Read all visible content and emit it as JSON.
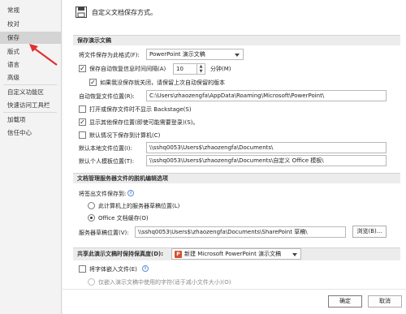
{
  "sidebar": {
    "items": [
      {
        "label": "常规"
      },
      {
        "label": "校对"
      },
      {
        "label": "保存"
      },
      {
        "label": "版式"
      },
      {
        "label": "语言"
      },
      {
        "label": "高级"
      },
      {
        "label": "自定义功能区"
      },
      {
        "label": "快速访问工具栏"
      },
      {
        "label": "加载项"
      },
      {
        "label": "信任中心"
      }
    ],
    "active_index": 2
  },
  "header": {
    "title": "自定义文档保存方式。",
    "icon": "save-icon"
  },
  "sections": {
    "save_presentations": "保存演示文稿",
    "offline_editing": "文档管理服务器文件的脱机编辑选项",
    "fidelity": "共享此演示文稿时保持保真度(D):"
  },
  "save": {
    "format_label": "将文件保存为此格式(F):",
    "format_value": "PowerPoint 演示文稿",
    "autorecover_label": "保存自动恢复信息时间间隔(A)",
    "autorecover_checked": true,
    "autorecover_minutes": "10",
    "minutes_label": "分钟(M)",
    "keep_last_label": "如果我没保存就关闭，请保留上次自动保留的版本",
    "keep_last_checked": true,
    "autorecover_location_label": "自动恢复文件位置(R):",
    "autorecover_location_value": "C:\\Users\\zhaozengfa\\AppData\\Roaming\\Microsoft\\PowerPoint\\",
    "no_backstage_label": "打开或保存文件时不显示 Backstage(S)",
    "no_backstage_checked": false,
    "show_additional_label": "显示其他保存位置(即使可能需要登录)(S)。",
    "show_additional_checked": true,
    "default_computer_label": "默认情况下保存到计算机(C)",
    "default_computer_checked": false,
    "default_local_label": "默认本地文件位置(I):",
    "default_local_value": "\\\\sshq0053\\Users$\\zhaozengfa\\Documents\\",
    "default_templates_label": "默认个人模板位置(T):",
    "default_templates_value": "\\\\sshq0053\\Users$\\zhaozengfa\\Documents\\自定义 Office 模板\\"
  },
  "offline": {
    "save_to_label": "将签出文件保存到:",
    "option_server": "此计算机上的服务器草稿位置(L)",
    "option_cache": "Office 文档缓存(O)",
    "selected": "cache",
    "drafts_label": "服务器草稿位置(V):",
    "drafts_value": "\\\\sshq0053\\Users$\\zhaozengfa\\Documents\\SharePoint 草稿\\",
    "browse_label": "浏览(B)..."
  },
  "fidelity": {
    "presentation_value": "新建 Microsoft PowerPoint 演示文稿",
    "embed_fonts_label": "将字体嵌入文件(E)",
    "embed_fonts_checked": false,
    "embed_only_used_label": "仅嵌入演示文稿中使用的字符(适于减小文件大小)(O)"
  },
  "footer": {
    "ok_label": "确定",
    "cancel_label": "取消"
  },
  "colors": {
    "accent": "#d35230",
    "arrow": "#e03030",
    "info": "#5b8fd6"
  }
}
